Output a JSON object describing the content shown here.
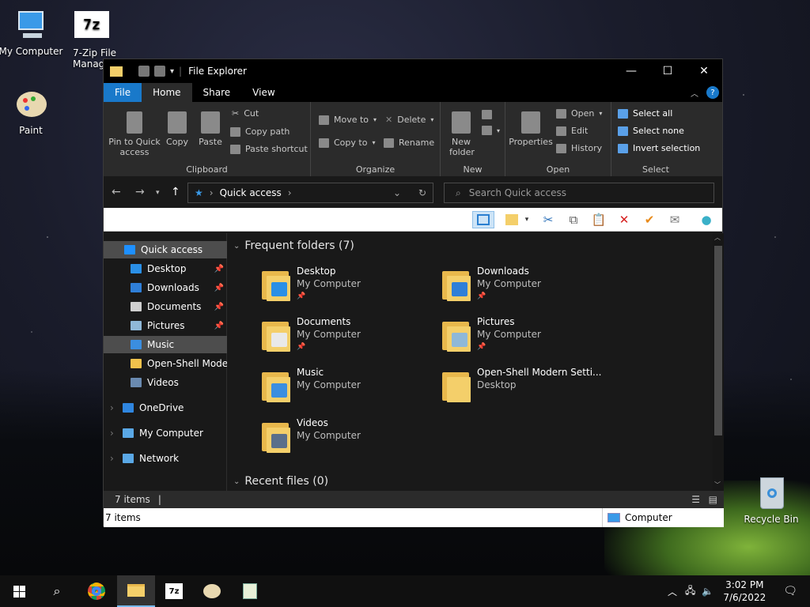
{
  "desktop": {
    "icons": [
      {
        "label": "My Computer"
      },
      {
        "label": "7-Zip File Manag"
      },
      {
        "label": "Paint"
      },
      {
        "label": "Recycle Bin"
      }
    ]
  },
  "window": {
    "title": "File Explorer",
    "controls": {
      "minimize": "—",
      "maximize": "☐",
      "close": "✕"
    },
    "tabs": [
      {
        "label": "File"
      },
      {
        "label": "Home"
      },
      {
        "label": "Share"
      },
      {
        "label": "View"
      }
    ],
    "help": "?",
    "ribbon": {
      "clipboard": {
        "label": "Clipboard",
        "pin": "Pin to Quick access",
        "copy": "Copy",
        "paste": "Paste",
        "cut": "Cut",
        "copy_path": "Copy path",
        "paste_shortcut": "Paste shortcut"
      },
      "organize": {
        "label": "Organize",
        "move_to": "Move to",
        "copy_to": "Copy to",
        "delete": "Delete",
        "rename": "Rename"
      },
      "new": {
        "label": "New",
        "new_folder": "New folder"
      },
      "open": {
        "label": "Open",
        "properties": "Properties",
        "open": "Open",
        "edit": "Edit",
        "history": "History"
      },
      "select": {
        "label": "Select",
        "select_all": "Select all",
        "select_none": "Select none",
        "invert": "Invert selection"
      }
    },
    "address": {
      "location": "Quick access"
    },
    "search": {
      "placeholder": "Search Quick access"
    },
    "nav_pane": [
      {
        "label": "Quick access",
        "color": "#1e90ff",
        "pinned": false
      },
      {
        "label": "Desktop",
        "color": "#2a8fe6",
        "pinned": true
      },
      {
        "label": "Downloads",
        "color": "#2f7fd8",
        "pinned": true
      },
      {
        "label": "Documents",
        "color": "#cfcfcf",
        "pinned": true
      },
      {
        "label": "Pictures",
        "color": "#8fb8d8",
        "pinned": true
      },
      {
        "label": "Music",
        "color": "#3b8ee0",
        "pinned": false
      },
      {
        "label": "Open-Shell Modern",
        "color": "#f0c24c",
        "pinned": false
      },
      {
        "label": "Videos",
        "color": "#6a8ab0",
        "pinned": false
      },
      {
        "label": "OneDrive",
        "color": "#2f86e0",
        "pinned": false
      },
      {
        "label": "My Computer",
        "color": "#5aa8e6",
        "pinned": false
      },
      {
        "label": "Network",
        "color": "#5aa8e6",
        "pinned": false
      }
    ],
    "frequent": {
      "header": "Frequent folders (7)",
      "folders": [
        {
          "name": "Desktop",
          "sub": "My Computer",
          "pin": "📌",
          "overlay": "#2a8fe6"
        },
        {
          "name": "Downloads",
          "sub": "My Computer",
          "pin": "📌",
          "overlay": "#2f7fd8"
        },
        {
          "name": "Documents",
          "sub": "My Computer",
          "pin": "📌",
          "overlay": "#e9e9e9"
        },
        {
          "name": "Pictures",
          "sub": "My Computer",
          "pin": "📌",
          "overlay": "#8fb8d8"
        },
        {
          "name": "Music",
          "sub": "My Computer",
          "pin": "",
          "overlay": "#3b8ee0"
        },
        {
          "name": "Open-Shell Modern Setti...",
          "sub": "Desktop",
          "pin": "",
          "overlay": ""
        },
        {
          "name": "Videos",
          "sub": "My Computer",
          "pin": "",
          "overlay": "#5a6f8a"
        }
      ]
    },
    "recent": {
      "header": "Recent files (0)"
    },
    "status": {
      "items": "7 items",
      "items2": "7 items",
      "location": "Computer"
    }
  },
  "taskbar": {
    "time": "3:02 PM",
    "date": "7/6/2022"
  }
}
